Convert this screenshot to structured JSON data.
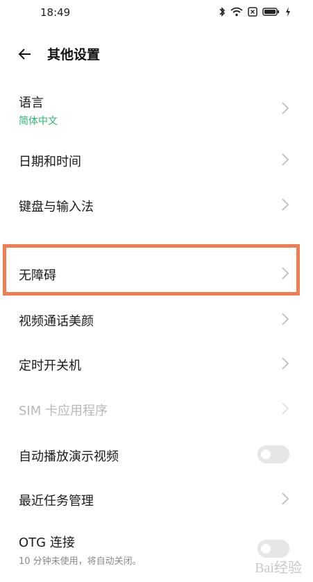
{
  "status_bar": {
    "time": "18:49"
  },
  "header": {
    "title": "其他设置"
  },
  "items": [
    {
      "label": "语言",
      "sub": "简体中文"
    },
    {
      "label": "日期和时间"
    },
    {
      "label": "键盘与输入法"
    },
    {
      "label": "无障碍"
    },
    {
      "label": "视频通话美颜"
    },
    {
      "label": "定时开关机"
    },
    {
      "label": "SIM 卡应用程序"
    },
    {
      "label": "自动播放演示视频",
      "toggle_on": false
    },
    {
      "label": "最近任务管理"
    },
    {
      "label": "OTG 连接",
      "sub": "10 分钟未使用，将自动关闭。"
    }
  ],
  "watermark": {
    "text": "Bai经验"
  },
  "colors": {
    "accent_green": "#2bb673",
    "highlight": "#f07c4f",
    "disabled_text": "#b8b8b8"
  }
}
